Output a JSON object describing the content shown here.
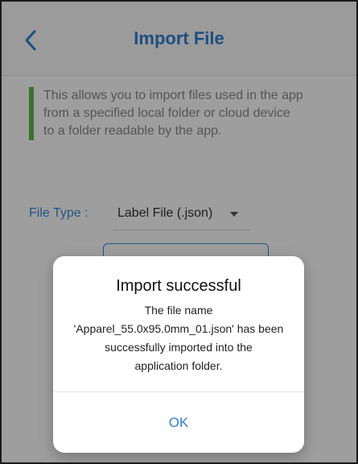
{
  "header": {
    "title": "Import File",
    "back_icon": "chevron-left-icon"
  },
  "info": {
    "lines": [
      "This allows you to import files used in the app",
      "from a specified local folder or cloud device",
      "to a folder readable by the app."
    ]
  },
  "file_type": {
    "label": "File Type :",
    "selected": "Label File (.json)"
  },
  "dialog": {
    "title": "Import successful",
    "message_lines": [
      "The file name",
      "'Apparel_55.0x95.0mm_01.json' has been",
      "successfully imported into the",
      "application folder."
    ],
    "ok_label": "OK"
  },
  "colors": {
    "accent": "#2f7fd1",
    "info_bar": "#63b547",
    "overlay": "rgba(0,0,0,0.38)"
  }
}
